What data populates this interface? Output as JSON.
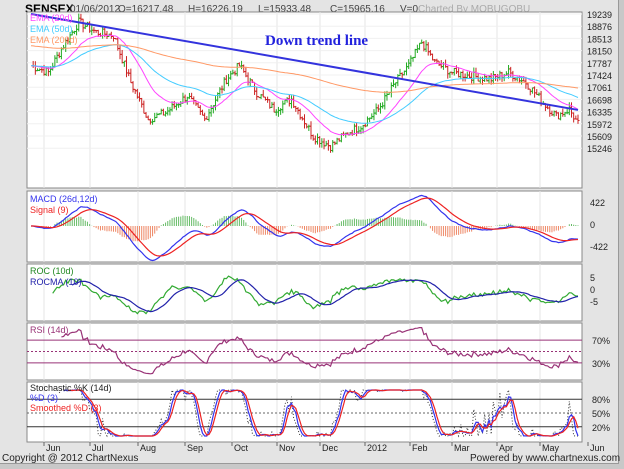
{
  "header": {
    "symbol": "SENSEX",
    "date": "01/06/2012",
    "open": "O=16217.48",
    "high": "H=16226.19",
    "low": "L=15933.48",
    "close": "C=15965.16",
    "volume": "V=0",
    "charted_by": "Charted By MOBUGOBU"
  },
  "footer": {
    "copyright": "Copyright @ 2012 ChartNexus",
    "powered": "Powered by www.chartnexus.com"
  },
  "chart_data": {
    "type": "candlestick",
    "title": "SENSEX",
    "annotation": "Down trend line",
    "ylim": [
      15100,
      19300
    ],
    "y_ticks": [
      "19239",
      "18876",
      "18513",
      "18150",
      "17787",
      "17424",
      "17061",
      "16698",
      "16335",
      "15972",
      "15609",
      "15246"
    ],
    "x_ticks": [
      "Jun",
      "Jul",
      "Aug",
      "Sep",
      "Oct",
      "Nov",
      "Dec",
      "2012",
      "Feb",
      "Mar",
      "Apr",
      "May",
      "Jun"
    ],
    "price_keypoints": [
      [
        0,
        17700
      ],
      [
        8,
        17500
      ],
      [
        14,
        18200
      ],
      [
        22,
        19000
      ],
      [
        30,
        18700
      ],
      [
        38,
        18600
      ],
      [
        46,
        17200
      ],
      [
        54,
        16100
      ],
      [
        62,
        16300
      ],
      [
        72,
        16800
      ],
      [
        80,
        16100
      ],
      [
        90,
        17300
      ],
      [
        96,
        17700
      ],
      [
        104,
        16900
      ],
      [
        112,
        16400
      ],
      [
        120,
        16700
      ],
      [
        130,
        15600
      ],
      [
        138,
        15300
      ],
      [
        146,
        15700
      ],
      [
        152,
        15900
      ],
      [
        160,
        16400
      ],
      [
        168,
        17200
      ],
      [
        174,
        17700
      ],
      [
        180,
        18400
      ],
      [
        186,
        17800
      ],
      [
        194,
        17500
      ],
      [
        202,
        17400
      ],
      [
        212,
        17300
      ],
      [
        220,
        17500
      ],
      [
        228,
        17200
      ],
      [
        236,
        16600
      ],
      [
        242,
        16200
      ],
      [
        248,
        16400
      ],
      [
        252,
        15965
      ]
    ],
    "down_trend_line": [
      [
        0,
        19239
      ],
      [
        252,
        16380
      ]
    ],
    "legend_main": [
      {
        "label": "EMA (20d)",
        "color": "#ff44ff"
      },
      {
        "label": "EMA (50d)",
        "color": "#44ccff"
      },
      {
        "label": "EMA (200d)",
        "color": "#ff9966"
      }
    ],
    "macd": {
      "legend": [
        "MACD (26d,12d)",
        "Signal (9)"
      ],
      "ticks": [
        "422",
        "0",
        "-422"
      ]
    },
    "roc": {
      "legend": [
        "ROC (10d)",
        "ROCMA (10)"
      ],
      "ticks": [
        "5",
        "0",
        "-5"
      ]
    },
    "rsi": {
      "legend": [
        "RSI (14d)"
      ],
      "ticks": [
        "70%",
        "30%"
      ]
    },
    "stoch": {
      "legend": [
        "Stochastic %K (14d)",
        "%D (3)",
        "Smoothed %D (3)"
      ],
      "ticks": [
        "80%",
        "50%",
        "20%"
      ]
    }
  }
}
